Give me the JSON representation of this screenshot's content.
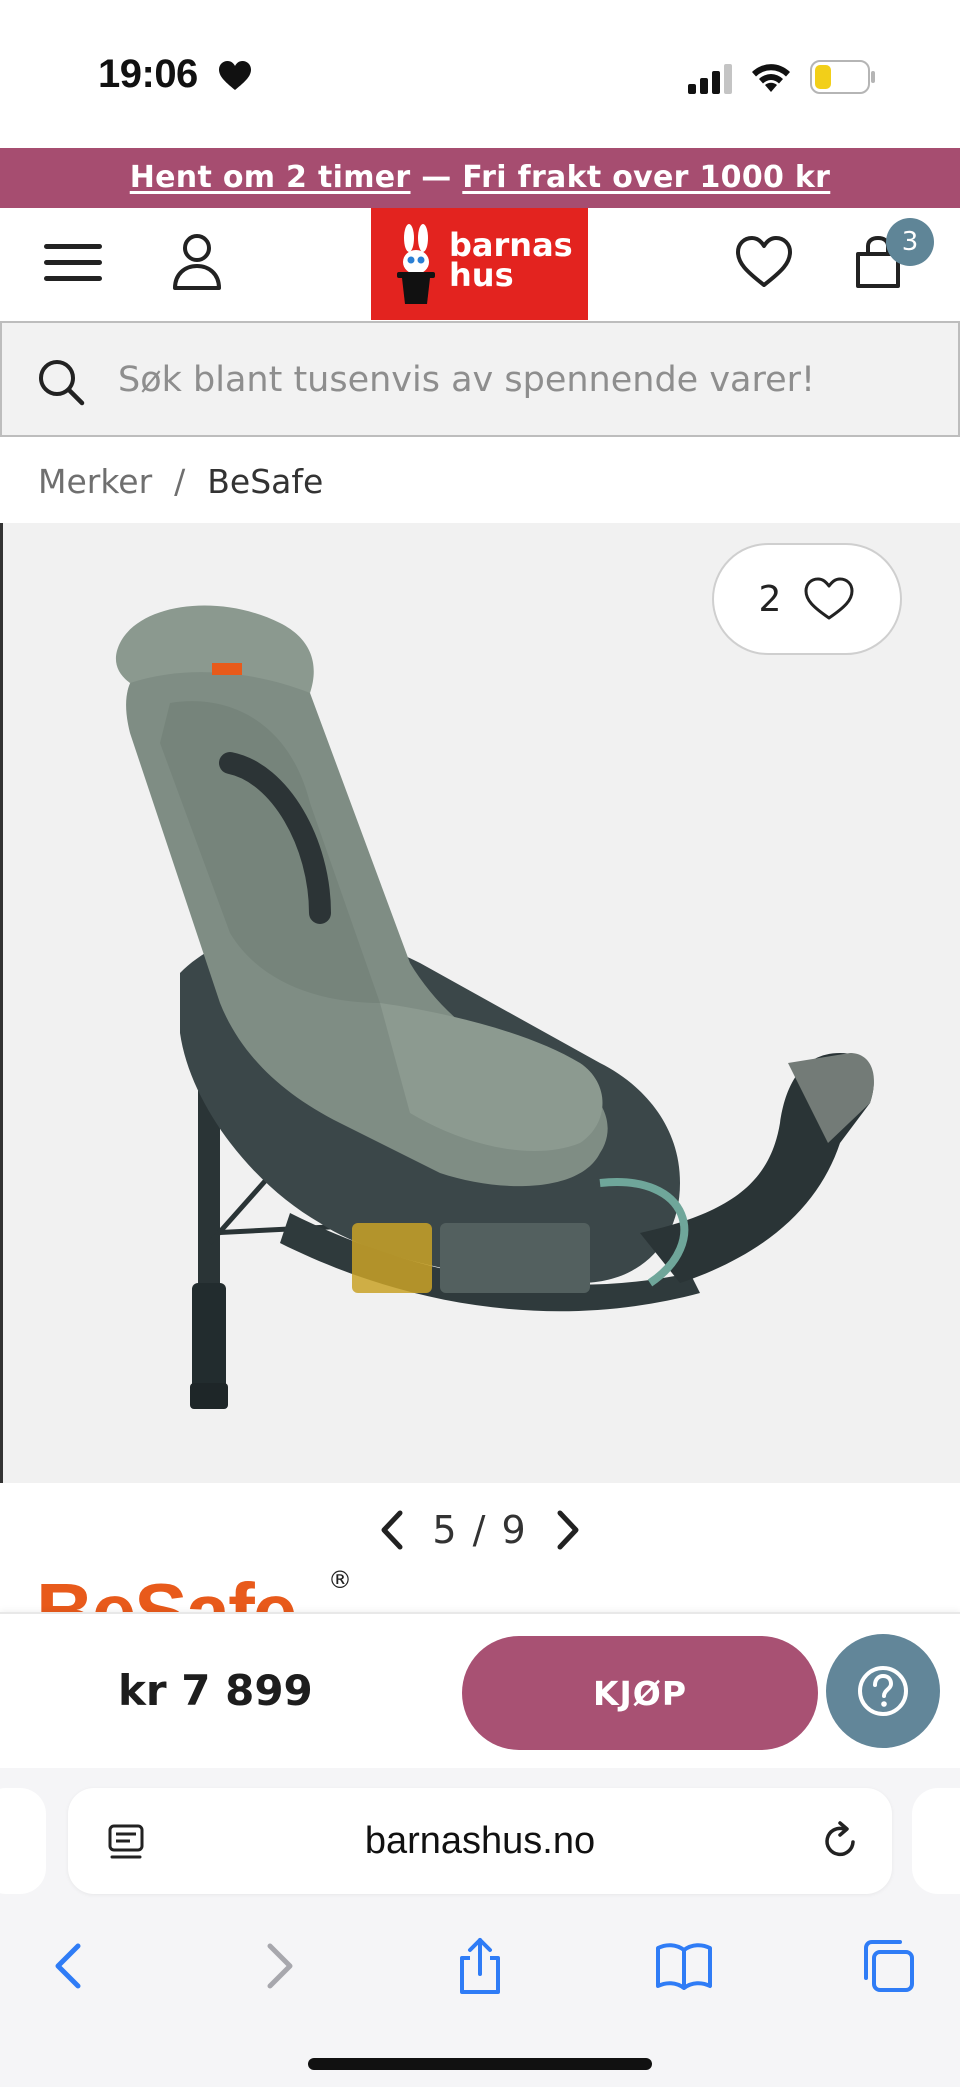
{
  "status_bar": {
    "time": "19:06"
  },
  "promo": {
    "pickup": "Hent om 2 timer",
    "separator": " — ",
    "shipping": "Fri frakt over 1000 kr"
  },
  "header": {
    "logo_line1": "barnas",
    "logo_line2": "hus",
    "cart_count": "3",
    "logo_color": "#e3231f"
  },
  "search": {
    "placeholder": "Søk blant tusenvis av spennende varer!"
  },
  "breadcrumb": {
    "items": [
      "Merker",
      "BeSafe"
    ],
    "separator": "/"
  },
  "product": {
    "like_count": "2",
    "image_index": "5",
    "image_total": "9",
    "pager_separator": "/",
    "brand": "BeSafe",
    "brand_registered": "®",
    "price": "kr 7 899",
    "buy_label": "KJØP",
    "brand_color": "#e85a1b",
    "accent_color": "#a85173"
  },
  "browser": {
    "url": "barnashus.no"
  },
  "icons": {
    "menu": "hamburger-icon",
    "account": "user-icon",
    "wishlist": "heart-icon",
    "cart": "bag-icon",
    "search": "search-icon",
    "help": "question-icon",
    "reload": "reload-icon",
    "reader": "reader-icon",
    "back": "chevron-left-icon",
    "forward": "chevron-right-icon",
    "share": "share-icon",
    "bookmarks": "book-icon",
    "tabs": "tabs-icon"
  }
}
